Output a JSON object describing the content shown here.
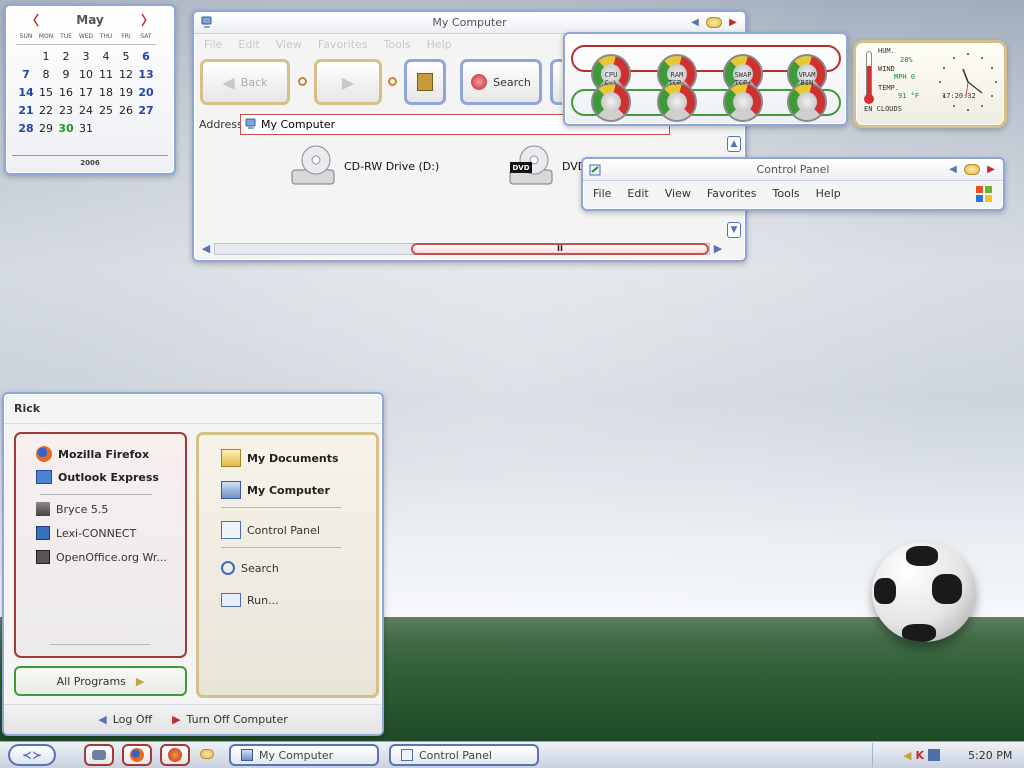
{
  "calendar": {
    "month": "May",
    "year": "2006",
    "dow": [
      "SUN",
      "MON",
      "TUE",
      "WED",
      "THU",
      "FRI",
      "SAT"
    ],
    "weeks": [
      [
        "",
        "1",
        "2",
        "3",
        "4",
        "5",
        "6"
      ],
      [
        "7",
        "8",
        "9",
        "10",
        "11",
        "12",
        "13"
      ],
      [
        "14",
        "15",
        "16",
        "17",
        "18",
        "19",
        "20"
      ],
      [
        "21",
        "22",
        "23",
        "24",
        "25",
        "26",
        "27"
      ],
      [
        "28",
        "29",
        "30",
        "31",
        "",
        "",
        ""
      ]
    ],
    "today": "30"
  },
  "mycomputer": {
    "title": "My Computer",
    "menu": [
      "File",
      "Edit",
      "View",
      "Favorites",
      "Tools",
      "Help"
    ],
    "back_label": "Back",
    "search_label": "Search",
    "address_label": "Address",
    "address_value": "My Computer",
    "drives": [
      {
        "label": "CD-RW Drive (D:)"
      },
      {
        "label": "DVD"
      }
    ],
    "drive_badge": "DVD",
    "scroll_thumb": "II"
  },
  "controlpanel": {
    "title": "Control Panel",
    "menu": [
      "File",
      "Edit",
      "View",
      "Favorites",
      "Tools",
      "Help"
    ]
  },
  "meters": {
    "labels": [
      {
        "top": "CPU",
        "bottom": "C:\\"
      },
      {
        "top": "RAM",
        "bottom": "TCP-"
      },
      {
        "top": "SWAP",
        "bottom": "TCP+"
      },
      {
        "top": "VRAM",
        "bottom": "BIN"
      }
    ]
  },
  "weather": {
    "hum_label": "HUM.",
    "hum_value": "28%",
    "wind_label": "WIND",
    "wind_value": "MPH 0",
    "temp_label": "TEMP.",
    "temp_value": "91 °F",
    "condition": "EN CLOUDS",
    "time": "17:20:32"
  },
  "startmenu": {
    "user": "Rick",
    "pinned": [
      {
        "label": "Mozilla Firefox",
        "icon": "firefox-icon"
      },
      {
        "label": "Outlook Express",
        "icon": "outlook-icon"
      }
    ],
    "recent": [
      {
        "label": "Bryce 5.5",
        "icon": "bryce-icon"
      },
      {
        "label": "Lexi-CONNECT",
        "icon": "app-icon"
      },
      {
        "label": "OpenOffice.org Wr...",
        "icon": "writer-icon"
      }
    ],
    "right": [
      {
        "label": "My Documents",
        "bold": true
      },
      {
        "label": "My Computer",
        "bold": true
      },
      {
        "label": "Control Panel",
        "bold": false
      },
      {
        "label": "Search",
        "bold": false
      },
      {
        "label": "Run...",
        "bold": false
      }
    ],
    "all_programs": "All Programs",
    "log_off": "Log Off",
    "turn_off": "Turn Off Computer"
  },
  "taskbar": {
    "tasks": [
      "My Computer",
      "Control Panel"
    ],
    "time": "5:20 PM"
  },
  "colors": {
    "accent_blue": "#8fa6d6",
    "accent_red": "#c4272e",
    "accent_gold": "#d6c089",
    "accent_green": "#3f9a3a"
  }
}
